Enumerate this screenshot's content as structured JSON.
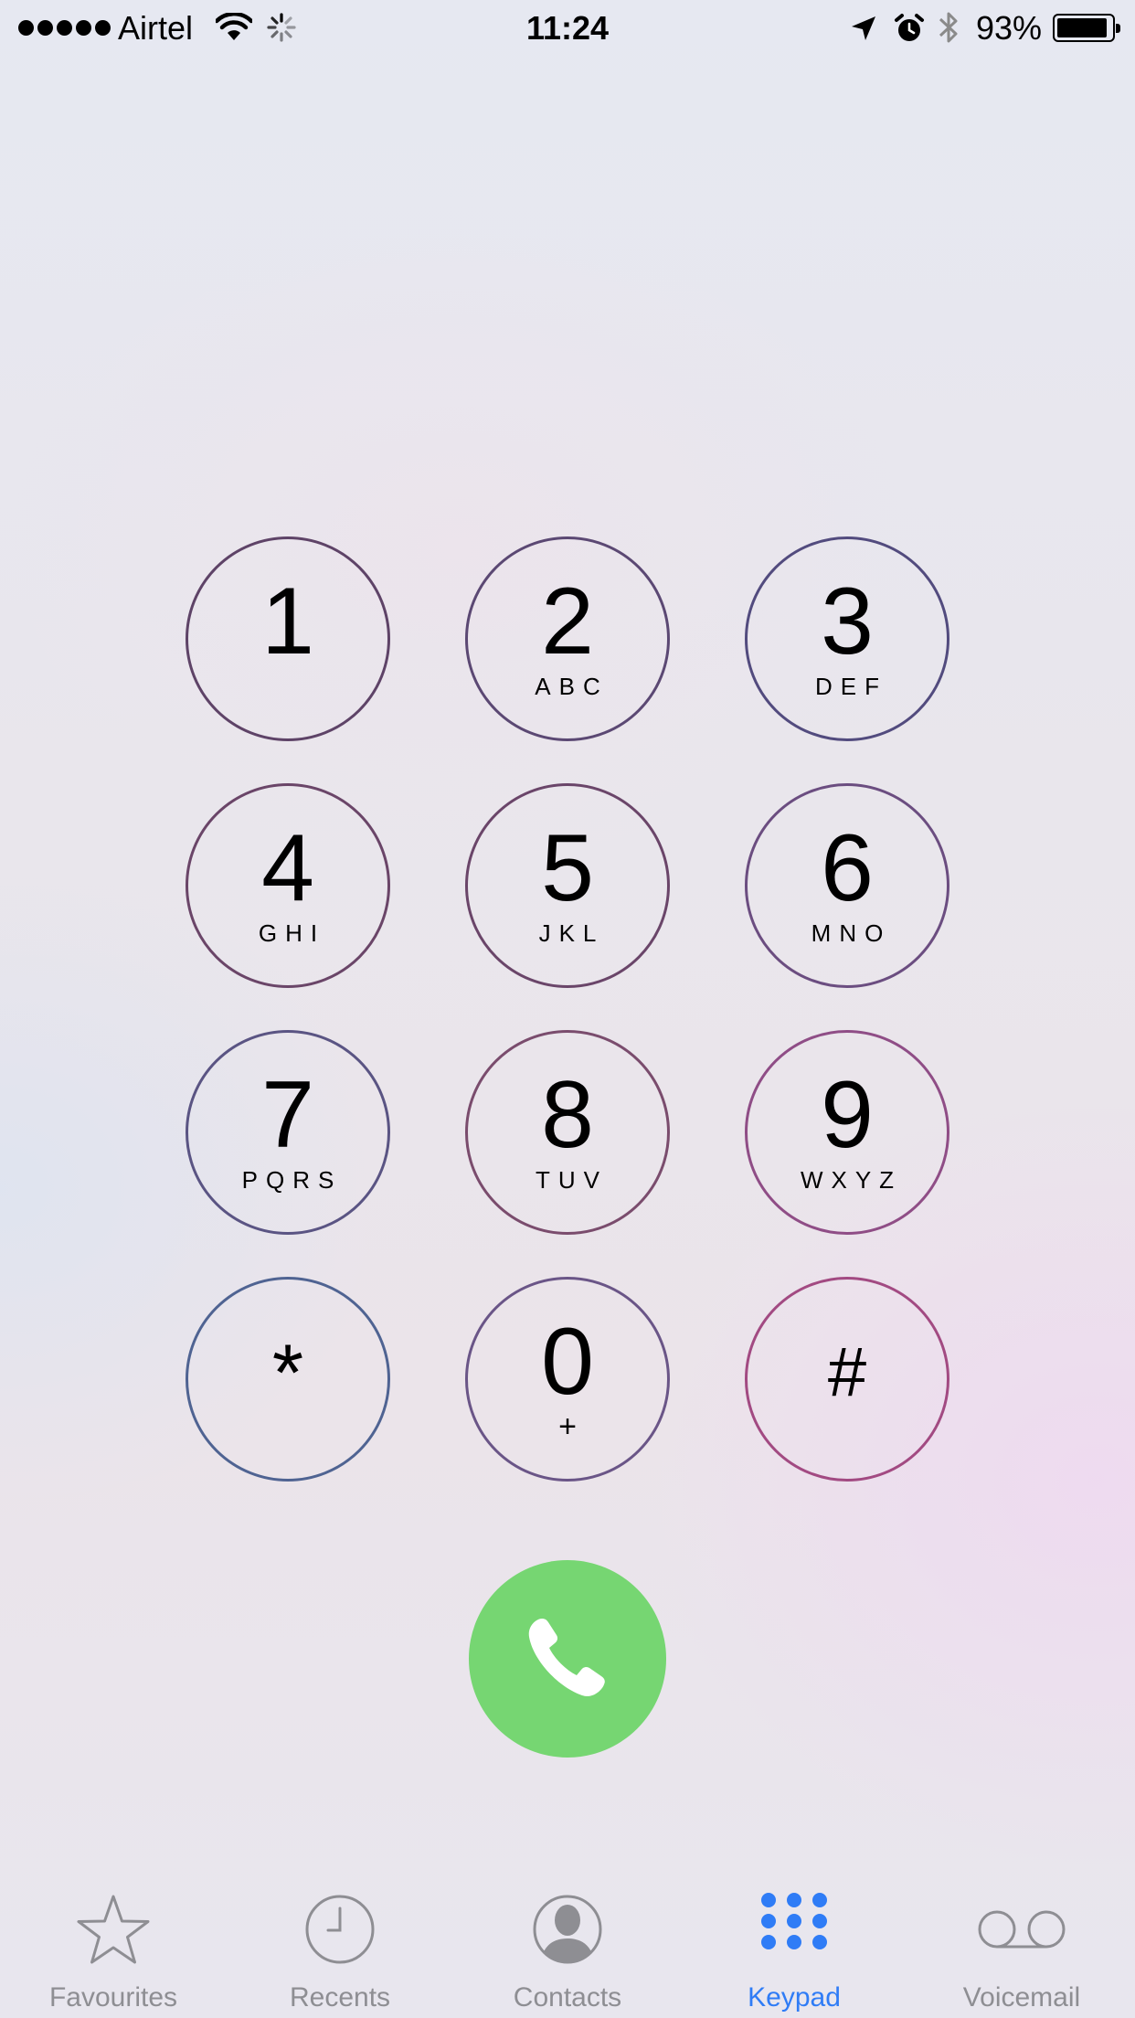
{
  "status_bar": {
    "carrier": "Airtel",
    "time": "11:24",
    "battery_percent": "93%",
    "battery_level": 0.93,
    "signal_dots": 5,
    "icons": [
      "signal-dots-icon",
      "wifi-icon",
      "activity-spinner-icon",
      "location-arrow-icon",
      "alarm-clock-icon",
      "bluetooth-icon",
      "battery-icon"
    ]
  },
  "keypad": {
    "keys": [
      {
        "digit": "1",
        "letters": ""
      },
      {
        "digit": "2",
        "letters": "ABC"
      },
      {
        "digit": "3",
        "letters": "DEF"
      },
      {
        "digit": "4",
        "letters": "GHI"
      },
      {
        "digit": "5",
        "letters": "JKL"
      },
      {
        "digit": "6",
        "letters": "MNO"
      },
      {
        "digit": "7",
        "letters": "PQRS"
      },
      {
        "digit": "8",
        "letters": "TUV"
      },
      {
        "digit": "9",
        "letters": "WXYZ"
      },
      {
        "digit": "*",
        "letters": ""
      },
      {
        "digit": "0",
        "letters": "+"
      },
      {
        "digit": "#",
        "letters": ""
      }
    ]
  },
  "call_button": {
    "icon": "phone-handset-icon",
    "color": "#76d672"
  },
  "tabs": [
    {
      "label": "Favourites",
      "icon": "star-icon",
      "active": false
    },
    {
      "label": "Recents",
      "icon": "clock-icon",
      "active": false
    },
    {
      "label": "Contacts",
      "icon": "contact-silhouette-icon",
      "active": false
    },
    {
      "label": "Keypad",
      "icon": "keypad-grid-icon",
      "active": true
    },
    {
      "label": "Voicemail",
      "icon": "voicemail-icon",
      "active": false
    }
  ],
  "colors": {
    "active_tab": "#2f7cf6",
    "inactive_tab": "#8e8e93",
    "call_green": "#76d672"
  }
}
